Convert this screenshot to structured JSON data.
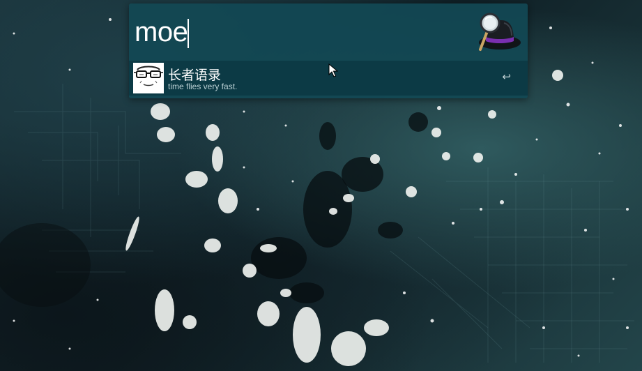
{
  "launcher": {
    "query": "moe",
    "logo_icon": "alfred-hat-magnifier-icon"
  },
  "results": [
    {
      "title": "长者语录",
      "subtitle": "time flies very fast.",
      "thumbnail_icon": "glasses-face-thumbnail-icon",
      "action_icon": "return-key-icon",
      "action_glyph": "↩"
    }
  ],
  "colors": {
    "launcher_background": "#124854",
    "result_background": "#08303a",
    "title_text": "#ffffff",
    "subtitle_text": "#b9cfd3",
    "hat_band": "#7a2fb0"
  }
}
